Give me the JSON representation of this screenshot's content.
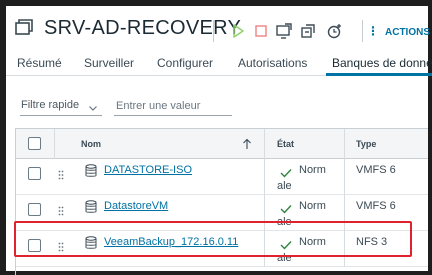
{
  "header": {
    "vm_name": "SRV-AD-RECOVERY",
    "actions_label": "ACTIONS",
    "toolbar_icons": [
      "power-on-icon",
      "power-off-icon",
      "launch-console-icon",
      "migrate-icon",
      "snapshot-icon"
    ]
  },
  "tabs": [
    {
      "label": "Résumé",
      "active": false
    },
    {
      "label": "Surveiller",
      "active": false
    },
    {
      "label": "Configurer",
      "active": false
    },
    {
      "label": "Autorisations",
      "active": false
    },
    {
      "label": "Banques de donné",
      "active": true
    }
  ],
  "filter": {
    "select_label": "Filtre rapide",
    "input_placeholder": "Entrer une valeur"
  },
  "table": {
    "columns": [
      "Nom",
      "État",
      "Type"
    ],
    "sort": {
      "column": "Nom",
      "direction": "ascending"
    },
    "rows": [
      {
        "name": "DATASTORE-ISO",
        "state": "Normale",
        "state_line1": "Norm",
        "state_line2": "ale",
        "type": "VMFS 6"
      },
      {
        "name": "DatastoreVM",
        "state": "Normale",
        "state_line1": "Norm",
        "state_line2": "ale",
        "type": "VMFS 6"
      },
      {
        "name": "VeeamBackup_172.16.0.11",
        "state": "Normale",
        "state_line1": "Norm",
        "state_line2": "ale",
        "type": "NFS 3",
        "highlighted": true
      }
    ]
  },
  "colors": {
    "accent": "#0072a3",
    "highlight": "#e0212e",
    "status_ok": "#2e8540",
    "power_on": "#8fd16a",
    "power_off": "#f08a8a"
  }
}
